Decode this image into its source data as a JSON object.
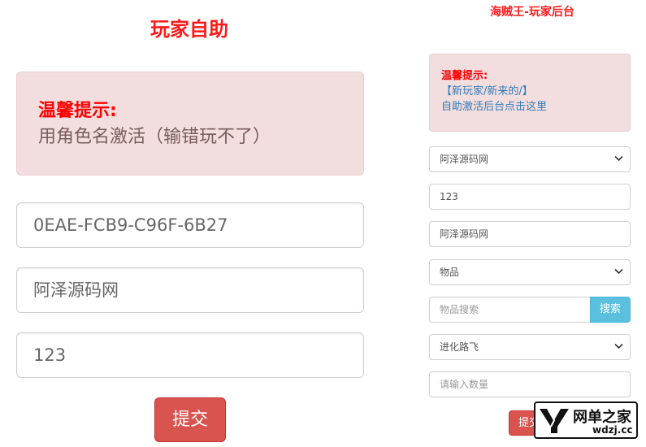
{
  "left": {
    "title": "玩家自助",
    "alert": {
      "title": "温馨提示:",
      "text": "用角色名激活（输错玩不了）"
    },
    "inputs": [
      {
        "value": "0EAE-FCB9-C96F-6B27"
      },
      {
        "value": "阿泽源码网"
      },
      {
        "value": "123"
      }
    ],
    "submit_label": "提交"
  },
  "right": {
    "title": "海贼王-玩家后台",
    "alert": {
      "title": "温馨提示:",
      "line1": "【新玩家/新来的/】",
      "line2": "自助激活后台点击这里"
    },
    "server_select": "阿泽源码网",
    "password_input": "123",
    "role_input": "阿泽源码网",
    "type_select": "物品",
    "search_placeholder": "物品搜索",
    "search_button": "搜索",
    "item_select": "进化路飞",
    "quantity_placeholder": "请输入数量",
    "submit_label": "提交"
  },
  "watermark": {
    "cn": "网单之家",
    "en": "wdzj.cc"
  },
  "colors": {
    "title_red": "#ff1a1a",
    "alert_bg": "#f2dedf",
    "danger": "#d9534f",
    "info": "#5bc0de",
    "link": "#337ab7"
  },
  "icons": {
    "select_arrow": "chevron-down-icon",
    "watermark_logo": "wdzj-logo-icon"
  }
}
